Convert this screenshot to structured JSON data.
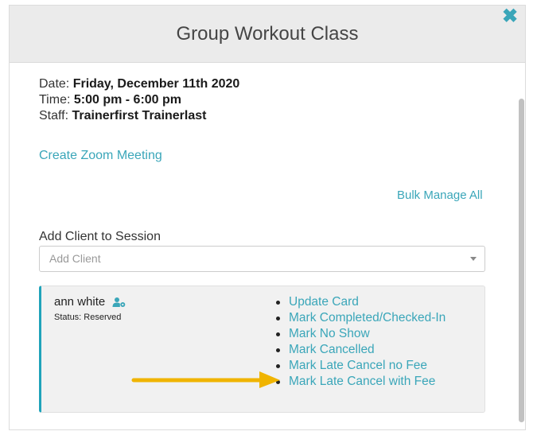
{
  "modal": {
    "title": "Group Workout Class",
    "close_glyph": "✖"
  },
  "session": {
    "date_label": "Date: ",
    "date_value": "Friday, December 11th 2020",
    "time_label": "Time: ",
    "time_value": "5:00 pm - 6:00 pm",
    "staff_label": "Staff: ",
    "staff_value": "Trainerfirst Trainerlast"
  },
  "links": {
    "zoom": "Create Zoom Meeting",
    "bulk_manage": "Bulk Manage All"
  },
  "add_client": {
    "label": "Add Client to Session",
    "placeholder": "Add Client"
  },
  "client": {
    "name": "ann white",
    "status": "Status: Reserved",
    "icon": "user-gear-icon",
    "actions": [
      "Update Card",
      "Mark Completed/Checked-In",
      "Mark No Show",
      "Mark Cancelled",
      "Mark Late Cancel no Fee",
      "Mark Late Cancel with Fee"
    ]
  },
  "colors": {
    "accent": "#3aa6b9",
    "card_border": "#1fa3ba",
    "arrow": "#f0b400",
    "header_bg": "#ebebeb"
  }
}
